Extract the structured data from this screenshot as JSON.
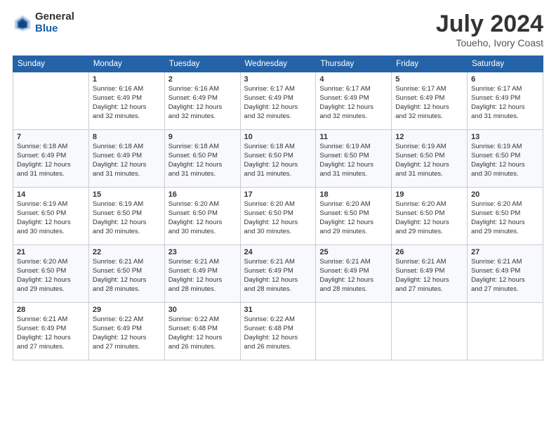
{
  "header": {
    "logo_general": "General",
    "logo_blue": "Blue",
    "title": "July 2024",
    "location": "Toueho, Ivory Coast"
  },
  "days_of_week": [
    "Sunday",
    "Monday",
    "Tuesday",
    "Wednesday",
    "Thursday",
    "Friday",
    "Saturday"
  ],
  "weeks": [
    [
      {
        "day": "",
        "info": ""
      },
      {
        "day": "1",
        "info": "Sunrise: 6:16 AM\nSunset: 6:49 PM\nDaylight: 12 hours\nand 32 minutes."
      },
      {
        "day": "2",
        "info": "Sunrise: 6:16 AM\nSunset: 6:49 PM\nDaylight: 12 hours\nand 32 minutes."
      },
      {
        "day": "3",
        "info": "Sunrise: 6:17 AM\nSunset: 6:49 PM\nDaylight: 12 hours\nand 32 minutes."
      },
      {
        "day": "4",
        "info": "Sunrise: 6:17 AM\nSunset: 6:49 PM\nDaylight: 12 hours\nand 32 minutes."
      },
      {
        "day": "5",
        "info": "Sunrise: 6:17 AM\nSunset: 6:49 PM\nDaylight: 12 hours\nand 32 minutes."
      },
      {
        "day": "6",
        "info": "Sunrise: 6:17 AM\nSunset: 6:49 PM\nDaylight: 12 hours\nand 31 minutes."
      }
    ],
    [
      {
        "day": "7",
        "info": "Sunrise: 6:18 AM\nSunset: 6:49 PM\nDaylight: 12 hours\nand 31 minutes."
      },
      {
        "day": "8",
        "info": "Sunrise: 6:18 AM\nSunset: 6:49 PM\nDaylight: 12 hours\nand 31 minutes."
      },
      {
        "day": "9",
        "info": "Sunrise: 6:18 AM\nSunset: 6:50 PM\nDaylight: 12 hours\nand 31 minutes."
      },
      {
        "day": "10",
        "info": "Sunrise: 6:18 AM\nSunset: 6:50 PM\nDaylight: 12 hours\nand 31 minutes."
      },
      {
        "day": "11",
        "info": "Sunrise: 6:19 AM\nSunset: 6:50 PM\nDaylight: 12 hours\nand 31 minutes."
      },
      {
        "day": "12",
        "info": "Sunrise: 6:19 AM\nSunset: 6:50 PM\nDaylight: 12 hours\nand 31 minutes."
      },
      {
        "day": "13",
        "info": "Sunrise: 6:19 AM\nSunset: 6:50 PM\nDaylight: 12 hours\nand 30 minutes."
      }
    ],
    [
      {
        "day": "14",
        "info": "Sunrise: 6:19 AM\nSunset: 6:50 PM\nDaylight: 12 hours\nand 30 minutes."
      },
      {
        "day": "15",
        "info": "Sunrise: 6:19 AM\nSunset: 6:50 PM\nDaylight: 12 hours\nand 30 minutes."
      },
      {
        "day": "16",
        "info": "Sunrise: 6:20 AM\nSunset: 6:50 PM\nDaylight: 12 hours\nand 30 minutes."
      },
      {
        "day": "17",
        "info": "Sunrise: 6:20 AM\nSunset: 6:50 PM\nDaylight: 12 hours\nand 30 minutes."
      },
      {
        "day": "18",
        "info": "Sunrise: 6:20 AM\nSunset: 6:50 PM\nDaylight: 12 hours\nand 29 minutes."
      },
      {
        "day": "19",
        "info": "Sunrise: 6:20 AM\nSunset: 6:50 PM\nDaylight: 12 hours\nand 29 minutes."
      },
      {
        "day": "20",
        "info": "Sunrise: 6:20 AM\nSunset: 6:50 PM\nDaylight: 12 hours\nand 29 minutes."
      }
    ],
    [
      {
        "day": "21",
        "info": "Sunrise: 6:20 AM\nSunset: 6:50 PM\nDaylight: 12 hours\nand 29 minutes."
      },
      {
        "day": "22",
        "info": "Sunrise: 6:21 AM\nSunset: 6:50 PM\nDaylight: 12 hours\nand 28 minutes."
      },
      {
        "day": "23",
        "info": "Sunrise: 6:21 AM\nSunset: 6:49 PM\nDaylight: 12 hours\nand 28 minutes."
      },
      {
        "day": "24",
        "info": "Sunrise: 6:21 AM\nSunset: 6:49 PM\nDaylight: 12 hours\nand 28 minutes."
      },
      {
        "day": "25",
        "info": "Sunrise: 6:21 AM\nSunset: 6:49 PM\nDaylight: 12 hours\nand 28 minutes."
      },
      {
        "day": "26",
        "info": "Sunrise: 6:21 AM\nSunset: 6:49 PM\nDaylight: 12 hours\nand 27 minutes."
      },
      {
        "day": "27",
        "info": "Sunrise: 6:21 AM\nSunset: 6:49 PM\nDaylight: 12 hours\nand 27 minutes."
      }
    ],
    [
      {
        "day": "28",
        "info": "Sunrise: 6:21 AM\nSunset: 6:49 PM\nDaylight: 12 hours\nand 27 minutes."
      },
      {
        "day": "29",
        "info": "Sunrise: 6:22 AM\nSunset: 6:49 PM\nDaylight: 12 hours\nand 27 minutes."
      },
      {
        "day": "30",
        "info": "Sunrise: 6:22 AM\nSunset: 6:48 PM\nDaylight: 12 hours\nand 26 minutes."
      },
      {
        "day": "31",
        "info": "Sunrise: 6:22 AM\nSunset: 6:48 PM\nDaylight: 12 hours\nand 26 minutes."
      },
      {
        "day": "",
        "info": ""
      },
      {
        "day": "",
        "info": ""
      },
      {
        "day": "",
        "info": ""
      }
    ]
  ]
}
